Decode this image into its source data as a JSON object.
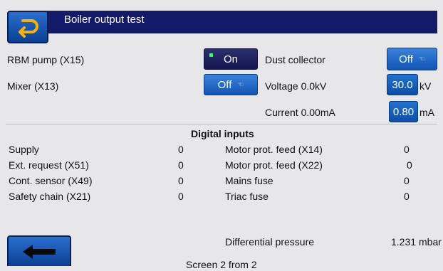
{
  "header": {
    "title": "Boiler output test"
  },
  "outputs": {
    "rbm_pump": {
      "label": "RBM pump (X15)",
      "state": "On"
    },
    "mixer": {
      "label": "Mixer (X13)",
      "state": "Off"
    },
    "dust_collector": {
      "label": "Dust collector",
      "state": "Off"
    },
    "voltage": {
      "label": "Voltage  0.0kV",
      "value": "30.0",
      "unit": "kV"
    },
    "current": {
      "label": "Current 0.00mA",
      "value": "0.80",
      "unit": "mA"
    }
  },
  "digital_inputs": {
    "title": "Digital inputs",
    "left": [
      {
        "label": "Supply",
        "value": "0"
      },
      {
        "label": "Ext. request (X51)",
        "value": "0"
      },
      {
        "label": "Cont. sensor (X49)",
        "value": "0"
      },
      {
        "label": "Safety chain (X21)",
        "value": "0"
      }
    ],
    "right": [
      {
        "label": "Motor prot. feed (X14)",
        "value": "0"
      },
      {
        "label": "Motor prot. feed (X22)",
        "value": "0"
      },
      {
        "label": "Mains fuse",
        "value": "0"
      },
      {
        "label": "Triac fuse",
        "value": "0"
      }
    ]
  },
  "differential_pressure": {
    "label": "Differential pressure",
    "value": "1.231",
    "unit": "mbar"
  },
  "footer": {
    "page_indicator": "Screen 2 from 2"
  },
  "icons": {
    "top_back": "return-arrow-icon",
    "bottom_back": "left-arrow-icon",
    "toggle_mode": "hand-icon"
  }
}
